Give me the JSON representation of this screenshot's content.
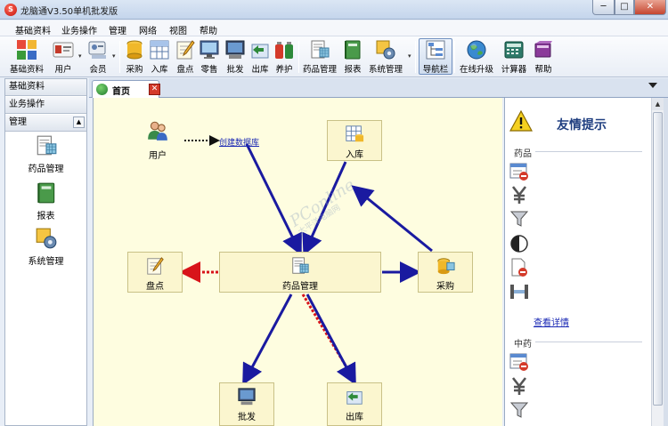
{
  "window": {
    "title": "龙脑通V3.50单机批发版",
    "app_icon_char": "S",
    "min_glyph": "─",
    "max_glyph": "□",
    "close_glyph": "✕"
  },
  "menu": [
    "基础资料",
    "业务操作",
    "管理",
    "网络",
    "视图",
    "帮助"
  ],
  "toolbar": {
    "buttons": [
      "基础资料",
      "用户",
      "会员",
      "采购",
      "入库",
      "盘点",
      "零售",
      "批发",
      "出库",
      "养护",
      "药品管理",
      "报表",
      "系统管理",
      "导航栏",
      "在线升级",
      "计算器",
      "帮助"
    ],
    "active": "导航栏",
    "dropdown_glyph": "▾"
  },
  "left_panel": {
    "headers": [
      "基础资料",
      "业务操作",
      "管理"
    ],
    "collapse_glyph": "▲",
    "items": [
      "药品管理",
      "报表",
      "系统管理"
    ]
  },
  "tabs": {
    "home_label": "首页",
    "close_glyph": "✕"
  },
  "flow": {
    "user_label": "用户",
    "create_db_link": "创建数据库",
    "nodes": {
      "ruku": "入库",
      "pandian": "盘点",
      "yaopin": "药品管理",
      "caigou": "采购",
      "pifa": "批发",
      "chuku": "出库"
    }
  },
  "watermark": {
    "main": "PConline",
    "sub": "太平洋电脑网"
  },
  "right_panel": {
    "title": "友情提示",
    "section_drugs": "药品",
    "view_details": "查看详情",
    "section_tcm": "中药"
  },
  "colors": {
    "canvas_bg": "#fefde0",
    "arrow_blue": "#1a1aa0",
    "arrow_red": "#d8141a",
    "link_blue": "#1a28b4",
    "panel_title": "#203f80"
  }
}
